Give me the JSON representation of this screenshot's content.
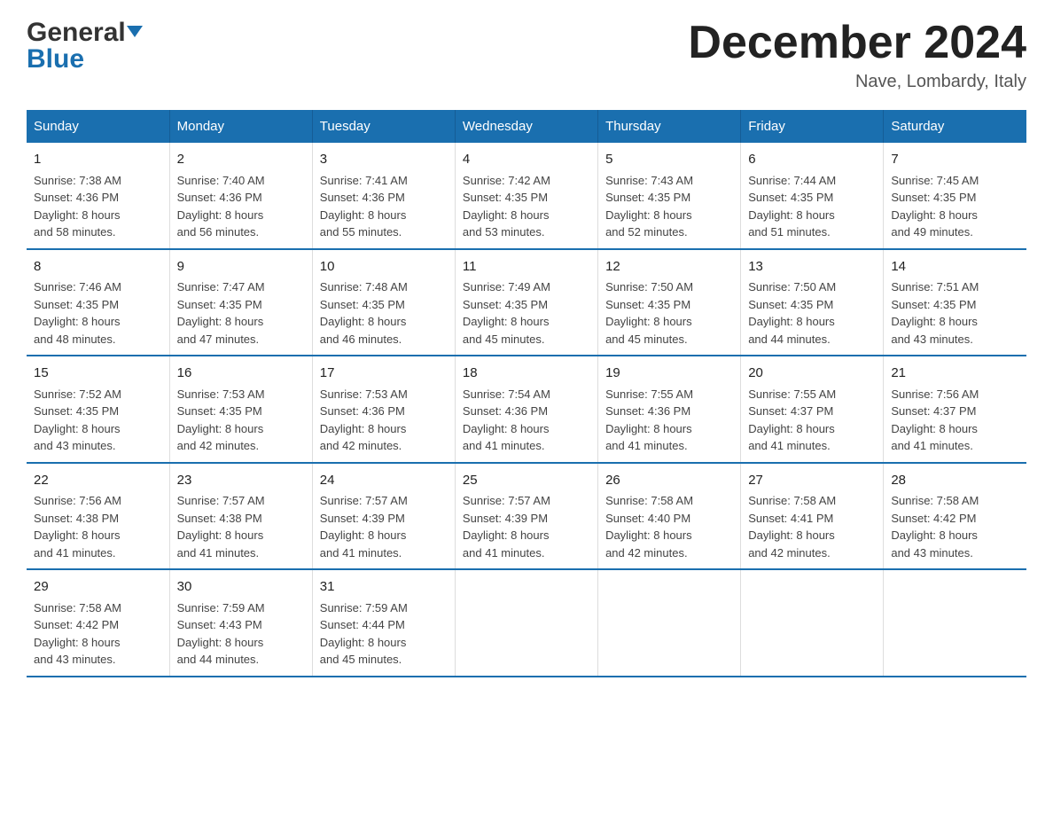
{
  "logo": {
    "general": "General",
    "blue": "Blue"
  },
  "title": "December 2024",
  "location": "Nave, Lombardy, Italy",
  "days_of_week": [
    "Sunday",
    "Monday",
    "Tuesday",
    "Wednesday",
    "Thursday",
    "Friday",
    "Saturday"
  ],
  "weeks": [
    [
      {
        "day": "1",
        "sunrise": "7:38 AM",
        "sunset": "4:36 PM",
        "daylight": "8 hours and 58 minutes."
      },
      {
        "day": "2",
        "sunrise": "7:40 AM",
        "sunset": "4:36 PM",
        "daylight": "8 hours and 56 minutes."
      },
      {
        "day": "3",
        "sunrise": "7:41 AM",
        "sunset": "4:36 PM",
        "daylight": "8 hours and 55 minutes."
      },
      {
        "day": "4",
        "sunrise": "7:42 AM",
        "sunset": "4:35 PM",
        "daylight": "8 hours and 53 minutes."
      },
      {
        "day": "5",
        "sunrise": "7:43 AM",
        "sunset": "4:35 PM",
        "daylight": "8 hours and 52 minutes."
      },
      {
        "day": "6",
        "sunrise": "7:44 AM",
        "sunset": "4:35 PM",
        "daylight": "8 hours and 51 minutes."
      },
      {
        "day": "7",
        "sunrise": "7:45 AM",
        "sunset": "4:35 PM",
        "daylight": "8 hours and 49 minutes."
      }
    ],
    [
      {
        "day": "8",
        "sunrise": "7:46 AM",
        "sunset": "4:35 PM",
        "daylight": "8 hours and 48 minutes."
      },
      {
        "day": "9",
        "sunrise": "7:47 AM",
        "sunset": "4:35 PM",
        "daylight": "8 hours and 47 minutes."
      },
      {
        "day": "10",
        "sunrise": "7:48 AM",
        "sunset": "4:35 PM",
        "daylight": "8 hours and 46 minutes."
      },
      {
        "day": "11",
        "sunrise": "7:49 AM",
        "sunset": "4:35 PM",
        "daylight": "8 hours and 45 minutes."
      },
      {
        "day": "12",
        "sunrise": "7:50 AM",
        "sunset": "4:35 PM",
        "daylight": "8 hours and 45 minutes."
      },
      {
        "day": "13",
        "sunrise": "7:50 AM",
        "sunset": "4:35 PM",
        "daylight": "8 hours and 44 minutes."
      },
      {
        "day": "14",
        "sunrise": "7:51 AM",
        "sunset": "4:35 PM",
        "daylight": "8 hours and 43 minutes."
      }
    ],
    [
      {
        "day": "15",
        "sunrise": "7:52 AM",
        "sunset": "4:35 PM",
        "daylight": "8 hours and 43 minutes."
      },
      {
        "day": "16",
        "sunrise": "7:53 AM",
        "sunset": "4:35 PM",
        "daylight": "8 hours and 42 minutes."
      },
      {
        "day": "17",
        "sunrise": "7:53 AM",
        "sunset": "4:36 PM",
        "daylight": "8 hours and 42 minutes."
      },
      {
        "day": "18",
        "sunrise": "7:54 AM",
        "sunset": "4:36 PM",
        "daylight": "8 hours and 41 minutes."
      },
      {
        "day": "19",
        "sunrise": "7:55 AM",
        "sunset": "4:36 PM",
        "daylight": "8 hours and 41 minutes."
      },
      {
        "day": "20",
        "sunrise": "7:55 AM",
        "sunset": "4:37 PM",
        "daylight": "8 hours and 41 minutes."
      },
      {
        "day": "21",
        "sunrise": "7:56 AM",
        "sunset": "4:37 PM",
        "daylight": "8 hours and 41 minutes."
      }
    ],
    [
      {
        "day": "22",
        "sunrise": "7:56 AM",
        "sunset": "4:38 PM",
        "daylight": "8 hours and 41 minutes."
      },
      {
        "day": "23",
        "sunrise": "7:57 AM",
        "sunset": "4:38 PM",
        "daylight": "8 hours and 41 minutes."
      },
      {
        "day": "24",
        "sunrise": "7:57 AM",
        "sunset": "4:39 PM",
        "daylight": "8 hours and 41 minutes."
      },
      {
        "day": "25",
        "sunrise": "7:57 AM",
        "sunset": "4:39 PM",
        "daylight": "8 hours and 41 minutes."
      },
      {
        "day": "26",
        "sunrise": "7:58 AM",
        "sunset": "4:40 PM",
        "daylight": "8 hours and 42 minutes."
      },
      {
        "day": "27",
        "sunrise": "7:58 AM",
        "sunset": "4:41 PM",
        "daylight": "8 hours and 42 minutes."
      },
      {
        "day": "28",
        "sunrise": "7:58 AM",
        "sunset": "4:42 PM",
        "daylight": "8 hours and 43 minutes."
      }
    ],
    [
      {
        "day": "29",
        "sunrise": "7:58 AM",
        "sunset": "4:42 PM",
        "daylight": "8 hours and 43 minutes."
      },
      {
        "day": "30",
        "sunrise": "7:59 AM",
        "sunset": "4:43 PM",
        "daylight": "8 hours and 44 minutes."
      },
      {
        "day": "31",
        "sunrise": "7:59 AM",
        "sunset": "4:44 PM",
        "daylight": "8 hours and 45 minutes."
      },
      null,
      null,
      null,
      null
    ]
  ],
  "labels": {
    "sunrise": "Sunrise:",
    "sunset": "Sunset:",
    "daylight": "Daylight:"
  }
}
